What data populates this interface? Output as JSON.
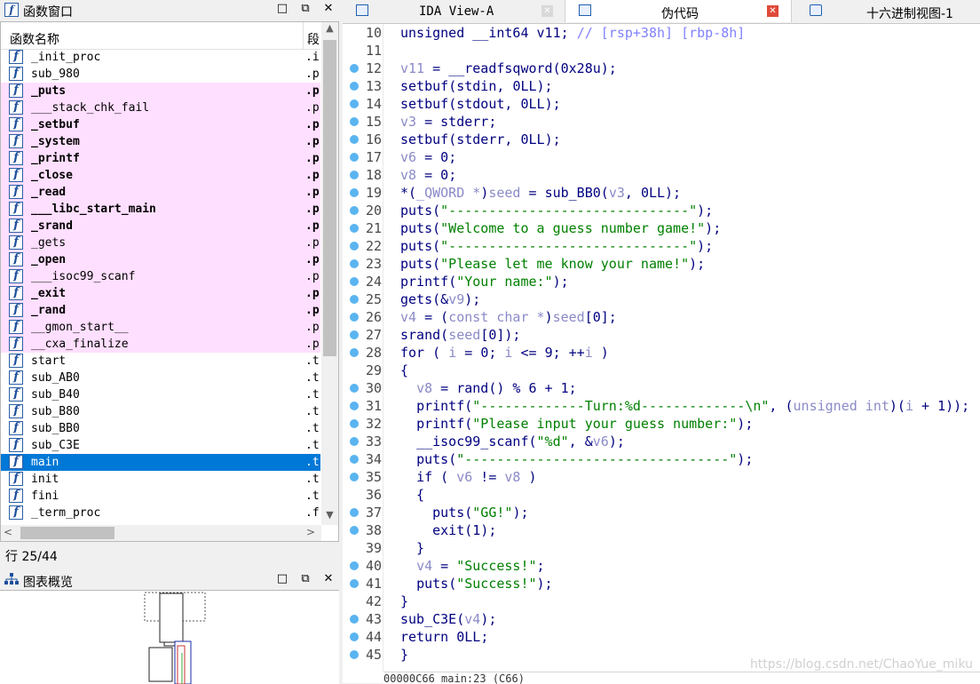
{
  "functions_window": {
    "title": "函数窗口",
    "col_name": "函数名称",
    "col_seg": "段",
    "rows": [
      {
        "name": "_init_proc",
        "seg": ".i",
        "lib": false,
        "bold": false
      },
      {
        "name": "sub_980",
        "seg": ".p",
        "lib": false,
        "bold": false
      },
      {
        "name": "_puts",
        "seg": ".p",
        "lib": true,
        "bold": true
      },
      {
        "name": "___stack_chk_fail",
        "seg": ".p",
        "lib": true,
        "bold": false
      },
      {
        "name": "_setbuf",
        "seg": ".p",
        "lib": true,
        "bold": true
      },
      {
        "name": "_system",
        "seg": ".p",
        "lib": true,
        "bold": true
      },
      {
        "name": "_printf",
        "seg": ".p",
        "lib": true,
        "bold": true
      },
      {
        "name": "_close",
        "seg": ".p",
        "lib": true,
        "bold": true
      },
      {
        "name": "_read",
        "seg": ".p",
        "lib": true,
        "bold": true
      },
      {
        "name": "___libc_start_main",
        "seg": ".p",
        "lib": true,
        "bold": true
      },
      {
        "name": "_srand",
        "seg": ".p",
        "lib": true,
        "bold": true
      },
      {
        "name": "_gets",
        "seg": ".p",
        "lib": true,
        "bold": false
      },
      {
        "name": "_open",
        "seg": ".p",
        "lib": true,
        "bold": true
      },
      {
        "name": "___isoc99_scanf",
        "seg": ".p",
        "lib": true,
        "bold": false
      },
      {
        "name": "_exit",
        "seg": ".p",
        "lib": true,
        "bold": true
      },
      {
        "name": "_rand",
        "seg": ".p",
        "lib": true,
        "bold": true
      },
      {
        "name": "__gmon_start__",
        "seg": ".p",
        "lib": true,
        "bold": false
      },
      {
        "name": "__cxa_finalize",
        "seg": ".p",
        "lib": true,
        "bold": false
      },
      {
        "name": "start",
        "seg": ".t",
        "lib": false,
        "bold": false
      },
      {
        "name": "sub_AB0",
        "seg": ".t",
        "lib": false,
        "bold": false
      },
      {
        "name": "sub_B40",
        "seg": ".t",
        "lib": false,
        "bold": false
      },
      {
        "name": "sub_B80",
        "seg": ".t",
        "lib": false,
        "bold": false
      },
      {
        "name": "sub_BB0",
        "seg": ".t",
        "lib": false,
        "bold": false
      },
      {
        "name": "sub_C3E",
        "seg": ".t",
        "lib": false,
        "bold": false
      },
      {
        "name": "main",
        "seg": ".t",
        "lib": false,
        "bold": false,
        "selected": true
      },
      {
        "name": "init",
        "seg": ".t",
        "lib": false,
        "bold": false
      },
      {
        "name": "fini",
        "seg": ".t",
        "lib": false,
        "bold": false
      },
      {
        "name": "_term_proc",
        "seg": ".f",
        "lib": false,
        "bold": false
      }
    ]
  },
  "status_line": "行 25/44",
  "graph_overview": {
    "title": "图表概览"
  },
  "tabs": [
    {
      "label": "IDA View-A",
      "active": false
    },
    {
      "label": "伪代码",
      "active": true
    },
    {
      "label": "十六进制视图-1",
      "active": false
    }
  ],
  "code": {
    "lines": [
      {
        "n": "10",
        "dot": false,
        "tokens": [
          [
            "kw",
            "unsigned __int64 "
          ],
          [
            "pu",
            "v11"
          ],
          [
            "pu",
            "; "
          ],
          [
            "cmt",
            "// [rsp+38h] [rbp-8h]"
          ]
        ]
      },
      {
        "n": "11",
        "dot": false,
        "tokens": []
      },
      {
        "n": "12",
        "dot": true,
        "tokens": [
          [
            "var",
            "v11"
          ],
          [
            "pu",
            " = "
          ],
          [
            "fn",
            "__readfsqword"
          ],
          [
            "pu",
            "("
          ],
          [
            "num",
            "0x28u"
          ],
          [
            "pu",
            ");"
          ]
        ]
      },
      {
        "n": "13",
        "dot": true,
        "tokens": [
          [
            "fn",
            "setbuf"
          ],
          [
            "pu",
            "("
          ],
          [
            "fn",
            "stdin"
          ],
          [
            "pu",
            ", "
          ],
          [
            "num",
            "0LL"
          ],
          [
            "pu",
            ");"
          ]
        ]
      },
      {
        "n": "14",
        "dot": true,
        "tokens": [
          [
            "fn",
            "setbuf"
          ],
          [
            "pu",
            "("
          ],
          [
            "fn",
            "stdout"
          ],
          [
            "pu",
            ", "
          ],
          [
            "num",
            "0LL"
          ],
          [
            "pu",
            ");"
          ]
        ]
      },
      {
        "n": "15",
        "dot": true,
        "tokens": [
          [
            "var",
            "v3"
          ],
          [
            "pu",
            " = "
          ],
          [
            "fn",
            "stderr"
          ],
          [
            "pu",
            ";"
          ]
        ]
      },
      {
        "n": "16",
        "dot": true,
        "tokens": [
          [
            "fn",
            "setbuf"
          ],
          [
            "pu",
            "("
          ],
          [
            "fn",
            "stderr"
          ],
          [
            "pu",
            ", "
          ],
          [
            "num",
            "0LL"
          ],
          [
            "pu",
            ");"
          ]
        ]
      },
      {
        "n": "17",
        "dot": true,
        "tokens": [
          [
            "var",
            "v6"
          ],
          [
            "pu",
            " = "
          ],
          [
            "num",
            "0"
          ],
          [
            "pu",
            ";"
          ]
        ]
      },
      {
        "n": "18",
        "dot": true,
        "tokens": [
          [
            "var",
            "v8"
          ],
          [
            "pu",
            " = "
          ],
          [
            "num",
            "0"
          ],
          [
            "pu",
            ";"
          ]
        ]
      },
      {
        "n": "19",
        "dot": true,
        "tokens": [
          [
            "pu",
            "*("
          ],
          [
            "var",
            "_QWORD *"
          ],
          [
            "pu",
            ")"
          ],
          [
            "var",
            "seed"
          ],
          [
            "pu",
            " = "
          ],
          [
            "fn",
            "sub_BB0"
          ],
          [
            "pu",
            "("
          ],
          [
            "var",
            "v3"
          ],
          [
            "pu",
            ", "
          ],
          [
            "num",
            "0LL"
          ],
          [
            "pu",
            ");"
          ]
        ]
      },
      {
        "n": "20",
        "dot": true,
        "tokens": [
          [
            "fn",
            "puts"
          ],
          [
            "pu",
            "("
          ],
          [
            "str",
            "\"------------------------------\""
          ],
          [
            "pu",
            ");"
          ]
        ]
      },
      {
        "n": "21",
        "dot": true,
        "tokens": [
          [
            "fn",
            "puts"
          ],
          [
            "pu",
            "("
          ],
          [
            "str",
            "\"Welcome to a guess number game!\""
          ],
          [
            "pu",
            ");"
          ]
        ]
      },
      {
        "n": "22",
        "dot": true,
        "tokens": [
          [
            "fn",
            "puts"
          ],
          [
            "pu",
            "("
          ],
          [
            "str",
            "\"------------------------------\""
          ],
          [
            "pu",
            ");"
          ]
        ]
      },
      {
        "n": "23",
        "dot": true,
        "tokens": [
          [
            "fn",
            "puts"
          ],
          [
            "pu",
            "("
          ],
          [
            "str",
            "\"Please let me know your name!\""
          ],
          [
            "pu",
            ");"
          ]
        ]
      },
      {
        "n": "24",
        "dot": true,
        "tokens": [
          [
            "fn",
            "printf"
          ],
          [
            "pu",
            "("
          ],
          [
            "str",
            "\"Your name:\""
          ],
          [
            "pu",
            ");"
          ]
        ]
      },
      {
        "n": "25",
        "dot": true,
        "tokens": [
          [
            "fn",
            "gets"
          ],
          [
            "pu",
            "(&"
          ],
          [
            "var",
            "v9"
          ],
          [
            "pu",
            ");"
          ]
        ]
      },
      {
        "n": "26",
        "dot": true,
        "tokens": [
          [
            "var",
            "v4"
          ],
          [
            "pu",
            " = ("
          ],
          [
            "var",
            "const char *"
          ],
          [
            "pu",
            ")"
          ],
          [
            "var",
            "seed"
          ],
          [
            "pu",
            "["
          ],
          [
            "num",
            "0"
          ],
          [
            "pu",
            "];"
          ]
        ]
      },
      {
        "n": "27",
        "dot": true,
        "tokens": [
          [
            "fn",
            "srand"
          ],
          [
            "pu",
            "("
          ],
          [
            "var",
            "seed"
          ],
          [
            "pu",
            "["
          ],
          [
            "num",
            "0"
          ],
          [
            "pu",
            "]);"
          ]
        ]
      },
      {
        "n": "28",
        "dot": true,
        "tokens": [
          [
            "kw",
            "for"
          ],
          [
            "pu",
            " ( "
          ],
          [
            "var",
            "i"
          ],
          [
            "pu",
            " = "
          ],
          [
            "num",
            "0"
          ],
          [
            "pu",
            "; "
          ],
          [
            "var",
            "i"
          ],
          [
            "pu",
            " <= "
          ],
          [
            "num",
            "9"
          ],
          [
            "pu",
            "; ++"
          ],
          [
            "var",
            "i"
          ],
          [
            "pu",
            " )"
          ]
        ]
      },
      {
        "n": "29",
        "dot": false,
        "tokens": [
          [
            "pu",
            "{"
          ]
        ]
      },
      {
        "n": "30",
        "dot": true,
        "tokens": [
          [
            "pu",
            "  "
          ],
          [
            "var",
            "v8"
          ],
          [
            "pu",
            " = "
          ],
          [
            "fn",
            "rand"
          ],
          [
            "pu",
            "() % "
          ],
          [
            "num",
            "6"
          ],
          [
            "pu",
            " + "
          ],
          [
            "num",
            "1"
          ],
          [
            "pu",
            ";"
          ]
        ]
      },
      {
        "n": "31",
        "dot": true,
        "tokens": [
          [
            "pu",
            "  "
          ],
          [
            "fn",
            "printf"
          ],
          [
            "pu",
            "("
          ],
          [
            "str",
            "\"-------------Turn:%d-------------\\n\""
          ],
          [
            "pu",
            ", ("
          ],
          [
            "var",
            "unsigned int"
          ],
          [
            "pu",
            ")("
          ],
          [
            "var",
            "i"
          ],
          [
            "pu",
            " + "
          ],
          [
            "num",
            "1"
          ],
          [
            "pu",
            "));"
          ]
        ]
      },
      {
        "n": "32",
        "dot": true,
        "tokens": [
          [
            "pu",
            "  "
          ],
          [
            "fn",
            "printf"
          ],
          [
            "pu",
            "("
          ],
          [
            "str",
            "\"Please input your guess number:\""
          ],
          [
            "pu",
            ");"
          ]
        ]
      },
      {
        "n": "33",
        "dot": true,
        "tokens": [
          [
            "pu",
            "  "
          ],
          [
            "fn",
            "__isoc99_scanf"
          ],
          [
            "pu",
            "("
          ],
          [
            "str",
            "\"%d\""
          ],
          [
            "pu",
            ", &"
          ],
          [
            "var",
            "v6"
          ],
          [
            "pu",
            ");"
          ]
        ]
      },
      {
        "n": "34",
        "dot": true,
        "tokens": [
          [
            "pu",
            "  "
          ],
          [
            "fn",
            "puts"
          ],
          [
            "pu",
            "("
          ],
          [
            "str",
            "\"---------------------------------\""
          ],
          [
            "pu",
            ");"
          ]
        ]
      },
      {
        "n": "35",
        "dot": true,
        "tokens": [
          [
            "pu",
            "  "
          ],
          [
            "kw",
            "if"
          ],
          [
            "pu",
            " ( "
          ],
          [
            "var",
            "v6"
          ],
          [
            "pu",
            " != "
          ],
          [
            "var",
            "v8"
          ],
          [
            "pu",
            " )"
          ]
        ]
      },
      {
        "n": "36",
        "dot": false,
        "tokens": [
          [
            "pu",
            "  {"
          ]
        ]
      },
      {
        "n": "37",
        "dot": true,
        "tokens": [
          [
            "pu",
            "    "
          ],
          [
            "fn",
            "puts"
          ],
          [
            "pu",
            "("
          ],
          [
            "str",
            "\"GG!\""
          ],
          [
            "pu",
            ");"
          ]
        ]
      },
      {
        "n": "38",
        "dot": true,
        "tokens": [
          [
            "pu",
            "    "
          ],
          [
            "fn",
            "exit"
          ],
          [
            "pu",
            "("
          ],
          [
            "num",
            "1"
          ],
          [
            "pu",
            ");"
          ]
        ]
      },
      {
        "n": "39",
        "dot": false,
        "tokens": [
          [
            "pu",
            "  }"
          ]
        ]
      },
      {
        "n": "40",
        "dot": true,
        "tokens": [
          [
            "pu",
            "  "
          ],
          [
            "var",
            "v4"
          ],
          [
            "pu",
            " = "
          ],
          [
            "str",
            "\"Success!\""
          ],
          [
            "pu",
            ";"
          ]
        ]
      },
      {
        "n": "41",
        "dot": true,
        "tokens": [
          [
            "pu",
            "  "
          ],
          [
            "fn",
            "puts"
          ],
          [
            "pu",
            "("
          ],
          [
            "str",
            "\"Success!\""
          ],
          [
            "pu",
            ");"
          ]
        ]
      },
      {
        "n": "42",
        "dot": false,
        "tokens": [
          [
            "pu",
            "}"
          ]
        ]
      },
      {
        "n": "43",
        "dot": true,
        "tokens": [
          [
            "fn",
            "sub_C3E"
          ],
          [
            "pu",
            "("
          ],
          [
            "var",
            "v4"
          ],
          [
            "pu",
            ");"
          ]
        ]
      },
      {
        "n": "44",
        "dot": true,
        "tokens": [
          [
            "kw",
            "return"
          ],
          [
            "pu",
            " "
          ],
          [
            "num",
            "0LL"
          ],
          [
            "pu",
            ";"
          ]
        ]
      },
      {
        "n": "45",
        "dot": true,
        "tokens": [
          [
            "pu",
            "}"
          ]
        ]
      }
    ]
  },
  "footer_text": "00000C66 main:23 (C66)",
  "watermark": "https://blog.csdn.net/ChaoYue_miku",
  "colors": {
    "selection": "#0078d7",
    "library_bg": "#ffdfff",
    "breakpoint_dot": "#5ab4f0",
    "string": "#008000",
    "keyword": "#000080"
  }
}
